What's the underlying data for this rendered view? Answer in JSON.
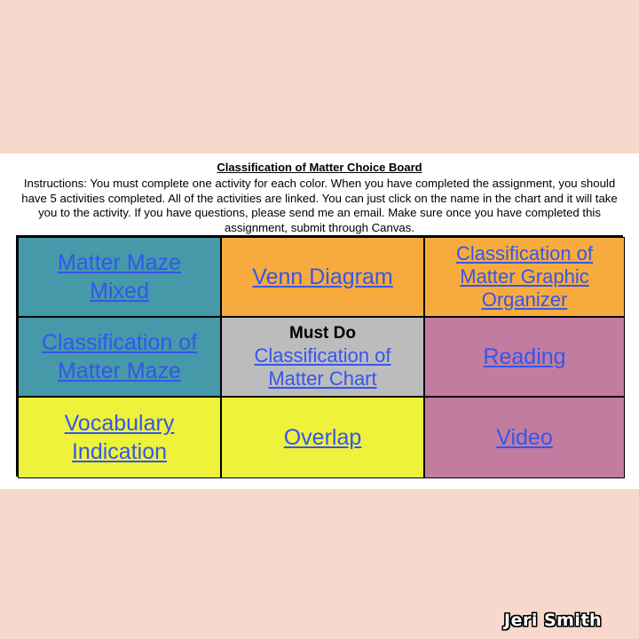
{
  "title": "Classification of Matter Choice Board",
  "instructions": "Instructions: You must complete one activity for each color. When you have completed the assignment, you should have 5 activities completed.  All of the activities are linked. You can just click on the name in the chart and it will take you to the activity. If you have questions, please send me an email. Make sure once you have completed this assignment, submit through Canvas.",
  "colors": {
    "background": "#f8d8cc",
    "teal": "#4599a8",
    "orange": "#f7ab3e",
    "gray": "#bcbcbc",
    "mauve": "#c27ca0",
    "yellow": "#eef23a",
    "link": "#3456ee"
  },
  "board": {
    "r1c1": {
      "label": "Matter Maze Mixed",
      "color": "teal"
    },
    "r1c2": {
      "label": "Venn Diagram",
      "color": "orange"
    },
    "r1c3": {
      "label": "Classification of Matter Graphic Organizer",
      "color": "orange"
    },
    "r2c1": {
      "label": "Classification of Matter Maze",
      "color": "teal"
    },
    "r2c2": {
      "heading": "Must Do",
      "label": "Classification of Matter Chart",
      "color": "gray"
    },
    "r2c3": {
      "label": "Reading",
      "color": "mauve"
    },
    "r3c1": {
      "label": "Vocabulary Indication",
      "color": "yellow"
    },
    "r3c2": {
      "label": "Overlap",
      "color": "yellow"
    },
    "r3c3": {
      "label": "Video",
      "color": "mauve"
    }
  },
  "signature": "Jeri Smith"
}
